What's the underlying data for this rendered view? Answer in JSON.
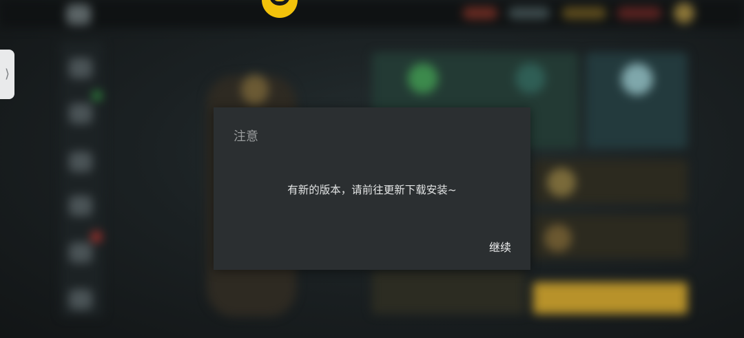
{
  "dialog": {
    "title": "注意",
    "message": "有新的版本，请前往更新下载安装~",
    "continue_label": "继续"
  },
  "side_handle": {
    "glyph": "⟩",
    "icon": "chevron-right-icon"
  },
  "logo": {
    "icon": "app-logo-icon",
    "color": "#f2c20b"
  },
  "colors": {
    "dialog_background": "#2b2f31",
    "title_text": "#9a9d9e",
    "message_text": "#e3e5e5",
    "accent_yellow": "#f2c20b"
  }
}
